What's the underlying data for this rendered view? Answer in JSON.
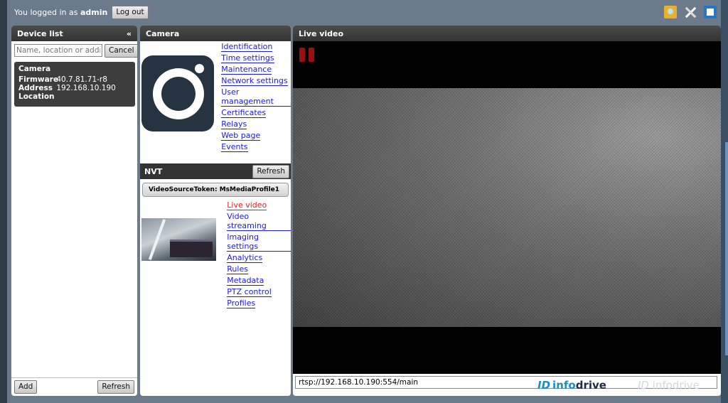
{
  "topbar": {
    "login_prefix": "You logged in as",
    "user": "admin",
    "logout_label": "Log out",
    "icons": [
      "folder-image-icon",
      "tools-icon",
      "help-book-icon"
    ]
  },
  "device_list": {
    "title": "Device list",
    "collapse_glyph": "«",
    "search_placeholder": "Name, location or address",
    "cancel_label": "Cancel",
    "device": {
      "name": "Camera",
      "firmware_label": "Firmware",
      "firmware_value": "40.7.81.71-r8",
      "address_label": "Address",
      "address_value": "192.168.10.190",
      "location_label": "Location",
      "location_value": ""
    },
    "add_label": "Add",
    "refresh_label": "Refresh"
  },
  "camera": {
    "title": "Camera",
    "links": [
      "Identification",
      "Time settings",
      "Maintenance",
      "Network settings",
      "User management",
      "Certificates",
      "Relays",
      "Web page",
      "Events"
    ],
    "nvt": {
      "title": "NVT",
      "refresh_label": "Refresh",
      "token_label": "VideoSourceToken:",
      "token_value": "MsMediaProfile1",
      "links": [
        "Live video",
        "Video streaming",
        "Imaging settings",
        "Analytics",
        "Rules",
        "Metadata",
        "PTZ control",
        "Profiles"
      ],
      "active_link": "Live video"
    }
  },
  "live_video": {
    "title": "Live video",
    "stream_url": "rtsp://192.168.10.190:554/main",
    "brand_mark": "ID",
    "brand_info": "info",
    "brand_drive": "drive",
    "brand_ghost_mark": "ID",
    "brand_ghost_text": "infodrive"
  },
  "colors": {
    "link": "#1a1ae6",
    "active_link": "#e62020",
    "header": "#333333",
    "background": "#6b7b8c"
  }
}
